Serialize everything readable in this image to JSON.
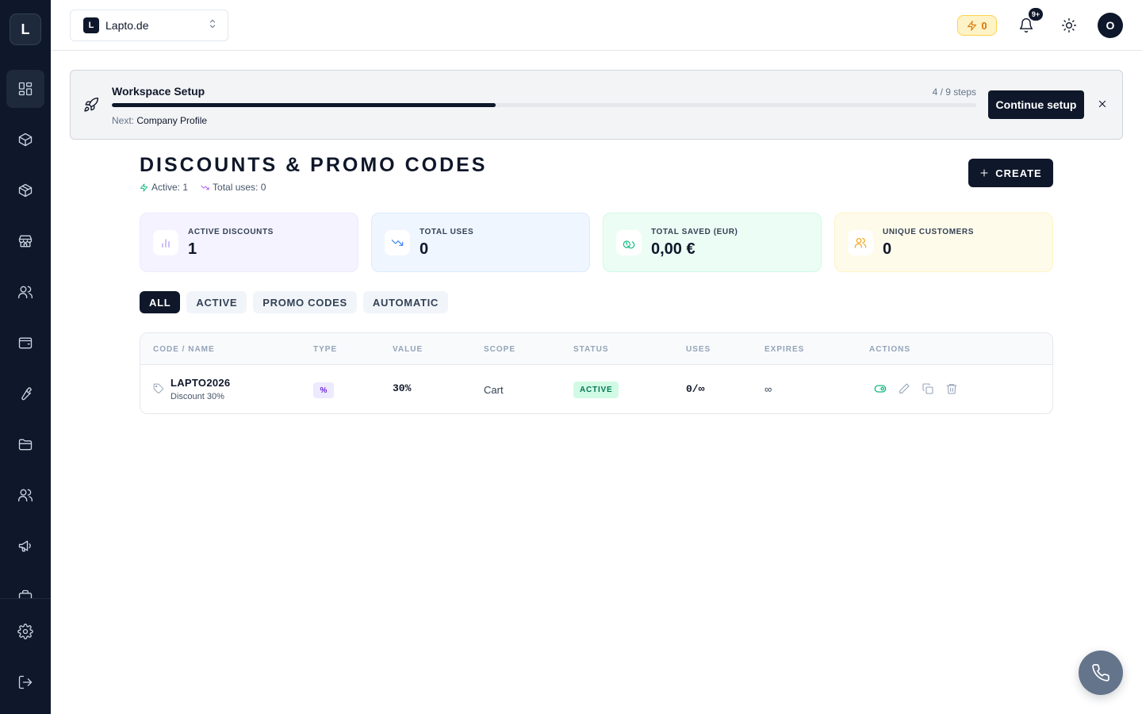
{
  "app": {
    "logo_letter": "L"
  },
  "sidebar": {
    "items": [
      {
        "icon": "dashboard-icon",
        "active": true
      },
      {
        "icon": "box-icon",
        "active": false
      },
      {
        "icon": "package-icon",
        "active": false
      },
      {
        "icon": "store-icon",
        "active": false
      },
      {
        "icon": "users-icon",
        "active": false
      },
      {
        "icon": "wallet-icon",
        "active": false
      },
      {
        "icon": "wrench-icon",
        "active": false
      },
      {
        "icon": "folder-icon",
        "active": false
      },
      {
        "icon": "team-icon",
        "active": false
      },
      {
        "icon": "megaphone-icon",
        "active": false
      }
    ],
    "bottom": [
      {
        "icon": "settings-icon"
      },
      {
        "icon": "logout-icon"
      }
    ]
  },
  "topbar": {
    "workspace_badge": "L",
    "workspace_name": "Lapto.de",
    "credits": "0",
    "notifications_badge": "9+",
    "avatar_letter": "O"
  },
  "setup": {
    "title": "Workspace Setup",
    "steps": "4 / 9 steps",
    "progress_done": 4,
    "progress_total": 9,
    "next_label": "Next:",
    "next_value": "Company Profile",
    "continue_label": "Continue setup"
  },
  "page": {
    "title": "DISCOUNTS & PROMO CODES",
    "active_meta": "Active: 1",
    "uses_meta": "Total uses: 0",
    "create_label": "CREATE"
  },
  "stats": [
    {
      "label": "ACTIVE DISCOUNTS",
      "value": "1",
      "icon": "bar-chart-icon"
    },
    {
      "label": "TOTAL USES",
      "value": "0",
      "icon": "trending-down-icon"
    },
    {
      "label": "TOTAL SAVED (EUR)",
      "value": "0,00 €",
      "icon": "coins-icon"
    },
    {
      "label": "UNIQUE CUSTOMERS",
      "value": "0",
      "icon": "users-icon"
    }
  ],
  "colors": {
    "primary": "#0f172a",
    "stat_purple_bg": "#f5f3ff",
    "stat_blue_bg": "#eff6ff",
    "stat_green_bg": "#ecfdf5",
    "stat_yellow_bg": "#fffbeb",
    "active_green": "#10b981"
  },
  "filters": [
    {
      "label": "ALL",
      "active": true
    },
    {
      "label": "ACTIVE",
      "active": false
    },
    {
      "label": "PROMO CODES",
      "active": false
    },
    {
      "label": "AUTOMATIC",
      "active": false
    }
  ],
  "table": {
    "columns": [
      "CODE / NAME",
      "TYPE",
      "VALUE",
      "SCOPE",
      "STATUS",
      "USES",
      "EXPIRES",
      "ACTIONS"
    ],
    "rows": [
      {
        "code": "LAPTO2026",
        "name": "Discount 30%",
        "type": "%",
        "value": "30%",
        "scope": "Cart",
        "status": "ACTIVE",
        "uses": "0/∞",
        "expires": "∞"
      }
    ]
  }
}
